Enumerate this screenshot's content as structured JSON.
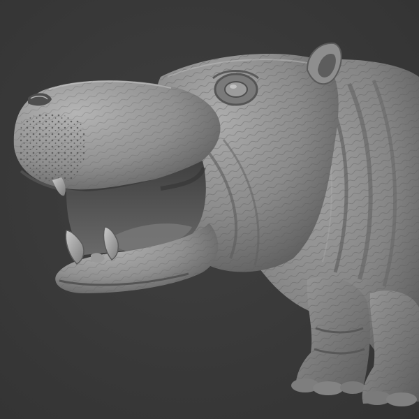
{
  "scene": {
    "subject": "hippopotamus-sculpt",
    "background_color": "#3a3a3a",
    "material_color": "#8c8c8c",
    "shadow_color": "#4a4a4a",
    "highlight_color": "#bdbdbd",
    "tusk_color": "#a8a8a8",
    "mouth_interior_color": "#5e5e5e"
  }
}
